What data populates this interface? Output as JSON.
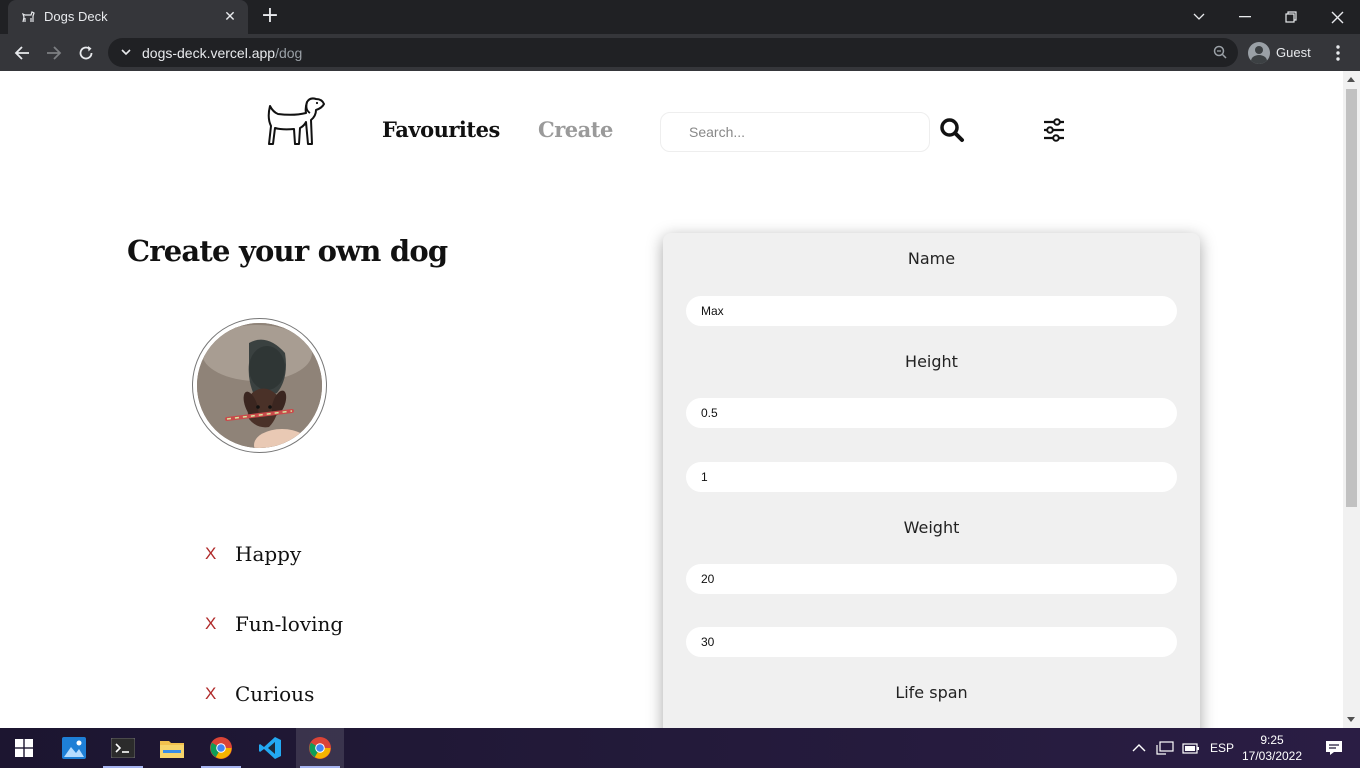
{
  "browser": {
    "tab_title": "Dogs Deck",
    "url_host": "dogs-deck.vercel.app",
    "url_path": "/dog",
    "profile_label": "Guest"
  },
  "nav": {
    "favourites_label": "Favourites",
    "create_label": "Create",
    "search_placeholder": "Search..."
  },
  "page": {
    "title": "Create your own dog",
    "temperaments": [
      {
        "remove_glyph": "X",
        "label": "Happy"
      },
      {
        "remove_glyph": "X",
        "label": "Fun-loving"
      },
      {
        "remove_glyph": "X",
        "label": "Curious"
      }
    ]
  },
  "form": {
    "name_label": "Name",
    "name_value": "Max",
    "height_label": "Height",
    "height_min": "0.5",
    "height_max": "1",
    "weight_label": "Weight",
    "weight_min": "20",
    "weight_max": "30",
    "lifespan_label": "Life span"
  },
  "taskbar": {
    "language": "ESP",
    "time": "9:25",
    "date": "17/03/2022"
  },
  "colors": {
    "remove_x": "#b02a2a",
    "form_bg": "#f0f0f0",
    "nav_inactive": "#9a9a9a"
  }
}
